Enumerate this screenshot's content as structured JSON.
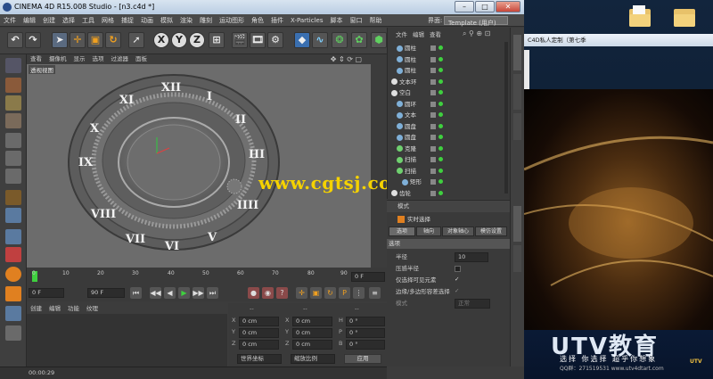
{
  "window": {
    "title": "CINEMA 4D R15.008 Studio - [n3.c4d *]",
    "minimize": "–",
    "maximize": "□",
    "close": "✕"
  },
  "menubar": {
    "items": [
      "文件",
      "编辑",
      "创建",
      "选择",
      "工具",
      "网格",
      "捕捉",
      "动画",
      "模拟",
      "渲染",
      "雕刻",
      "运动图形",
      "角色",
      "插件",
      "X-Particles",
      "脚本",
      "窗口",
      "帮助"
    ],
    "layout_label": "界面:",
    "layout_value": "Template (用户)"
  },
  "toolbar": {
    "x_label": "X",
    "y_label": "Y",
    "z_label": "Z"
  },
  "viewport": {
    "menu": [
      "查看",
      "摄像机",
      "显示",
      "选项",
      "过滤器",
      "面板"
    ],
    "label": "透视视图",
    "roman_numerals": [
      "XII",
      "I",
      "II",
      "III",
      "IIII",
      "V",
      "VI",
      "VII",
      "VIII",
      "IX",
      "X",
      "XI"
    ]
  },
  "watermark": "www.cgtsj.com",
  "timeline": {
    "ticks": [
      "0",
      "10",
      "20",
      "30",
      "40",
      "50",
      "60",
      "70",
      "80",
      "90"
    ],
    "end_field": "0 F",
    "start_field": "0 F",
    "end_frame": "90 F"
  },
  "transport": {
    "buttons": [
      "⏮",
      "◀◀",
      "◀",
      "▶",
      "▶▶",
      "⏭"
    ]
  },
  "material": {
    "menu": [
      "创建",
      "编辑",
      "功能",
      "纹理"
    ]
  },
  "coordinates": {
    "header": [
      "--",
      "--",
      "--"
    ],
    "rows": [
      {
        "a": "X",
        "av": "0 cm",
        "b": "X",
        "bv": "0 cm",
        "c": "H",
        "cv": "0 °"
      },
      {
        "a": "Y",
        "av": "0 cm",
        "b": "Y",
        "bv": "0 cm",
        "c": "P",
        "cv": "0 °"
      },
      {
        "a": "Z",
        "av": "0 cm",
        "b": "Z",
        "bv": "0 cm",
        "c": "B",
        "cv": "0 °"
      }
    ],
    "mode_left": "世界坐标",
    "mode_right": "缩放比例",
    "apply": "应用"
  },
  "status": {
    "time": "00:00:29"
  },
  "objects": {
    "menu": [
      "文件",
      "编辑",
      "查看",
      "对象",
      "标签",
      "书签"
    ],
    "rows": [
      {
        "name": "圆柱",
        "indent": 1,
        "color": "#7fb0d8"
      },
      {
        "name": "圆柱",
        "indent": 1,
        "color": "#7fb0d8"
      },
      {
        "name": "圆柱",
        "indent": 1,
        "color": "#7fb0d8"
      },
      {
        "name": "文本环",
        "indent": 0,
        "color": "#e0e0e0"
      },
      {
        "name": "空白",
        "indent": 0,
        "color": "#e0e0e0"
      },
      {
        "name": "圆环",
        "indent": 1,
        "color": "#7fb0d8"
      },
      {
        "name": "文本",
        "indent": 1,
        "color": "#7fb0d8"
      },
      {
        "name": "圆盘",
        "indent": 1,
        "color": "#7fb0d8"
      },
      {
        "name": "圆盘",
        "indent": 1,
        "color": "#7fb0d8"
      },
      {
        "name": "克隆",
        "indent": 1,
        "color": "#6fd06f"
      },
      {
        "name": "扫描",
        "indent": 1,
        "color": "#6fd06f"
      },
      {
        "name": "扫描",
        "indent": 1,
        "color": "#6fd06f"
      },
      {
        "name": "矩形",
        "indent": 2,
        "color": "#7fb0d8"
      },
      {
        "name": "齿轮",
        "indent": 0,
        "color": "#e0e0e0"
      }
    ]
  },
  "attributes": {
    "mode": "模式",
    "title": "实时选择",
    "tabs": [
      "选项",
      "轴向",
      "对象轴心",
      "模仿设置"
    ],
    "section": "选项",
    "radius_label": "半径",
    "radius_value": "10",
    "rows": [
      "压感半径",
      "仅选择可见元素",
      "边缘/多边形容差选择",
      "模式"
    ],
    "mode_value": "正常"
  },
  "desktop": {
    "task_title": "C4D私人定制（第七季",
    "brand": "UTV教育",
    "slogan": "选择 你选择  超乎你想象",
    "qq": "QQ群：271519531   www.utv4dtart.com",
    "corner": "UTV"
  }
}
